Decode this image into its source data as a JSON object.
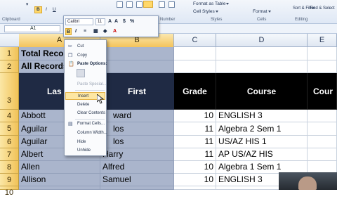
{
  "ribbon": {
    "clipboard_label": "Clipboard",
    "number_label": "Number",
    "styles_label": "Styles",
    "cells_label": "Cells",
    "editing_label": "Editing",
    "format_as_table": "Format as Table",
    "cell_styles": "Cell Styles",
    "format": "Format",
    "sort_filter": "Sort & Filter",
    "find_select": "Find & Select"
  },
  "formula_bar": {
    "name_box": "A1"
  },
  "mini_toolbar": {
    "font": "Calibri",
    "size": "11",
    "bold": "B",
    "italic": "I"
  },
  "columns": [
    "A",
    "B",
    "C",
    "D",
    "E"
  ],
  "rows": [
    {
      "n": "1",
      "a": "Total Recor",
      "b": "",
      "c": "",
      "d": "",
      "e": ""
    },
    {
      "n": "2",
      "a": "All Records",
      "b": "",
      "c": "",
      "d": "",
      "e": ""
    },
    {
      "n": "3",
      "a": "Las",
      "b": "First",
      "c": "Grade",
      "d": "Course",
      "e": "Cour"
    },
    {
      "n": "4",
      "a": "Abbott",
      "b": "ward",
      "c": "10",
      "d": "ENGLISH 3",
      "e": ""
    },
    {
      "n": "5",
      "a": "Aguilar",
      "b": "los",
      "c": "11",
      "d": "Algebra 2 Sem 1",
      "e": ""
    },
    {
      "n": "6",
      "a": "Aguilar",
      "b": "los",
      "c": "11",
      "d": "US/AZ HIS 1",
      "e": ""
    },
    {
      "n": "7",
      "a": "Albert",
      "b": "Harry",
      "c": "11",
      "d": "AP US/AZ HIS",
      "e": ""
    },
    {
      "n": "8",
      "a": "Allen",
      "b": "Alfred",
      "c": "10",
      "d": "Algebra 1 Sem 1",
      "e": ""
    },
    {
      "n": "9",
      "a": "Allison",
      "b": "Samuel",
      "c": "10",
      "d": "ENGLISH 3",
      "e": ""
    },
    {
      "n": "10",
      "a": "",
      "b": "",
      "c": "",
      "d": "",
      "e": ""
    }
  ],
  "context_menu": {
    "cut": "Cut",
    "copy": "Copy",
    "paste_options": "Paste Options:",
    "paste_special": "Paste Special...",
    "insert": "Insert",
    "delete": "Delete",
    "clear_contents": "Clear Contents",
    "format_cells": "Format Cells...",
    "column_width": "Column Width...",
    "hide": "Hide",
    "unhide": "Unhide"
  },
  "colors": {
    "selection": "#aab5cc",
    "header_dark": "#000000",
    "header_selected": "#1f2a44",
    "highlight": "#ffd86a"
  },
  "icons": [
    "scissors-icon",
    "copy-icon",
    "paste-icon",
    "insert-icon",
    "format-cells-icon",
    "mouse-cursor-icon"
  ]
}
